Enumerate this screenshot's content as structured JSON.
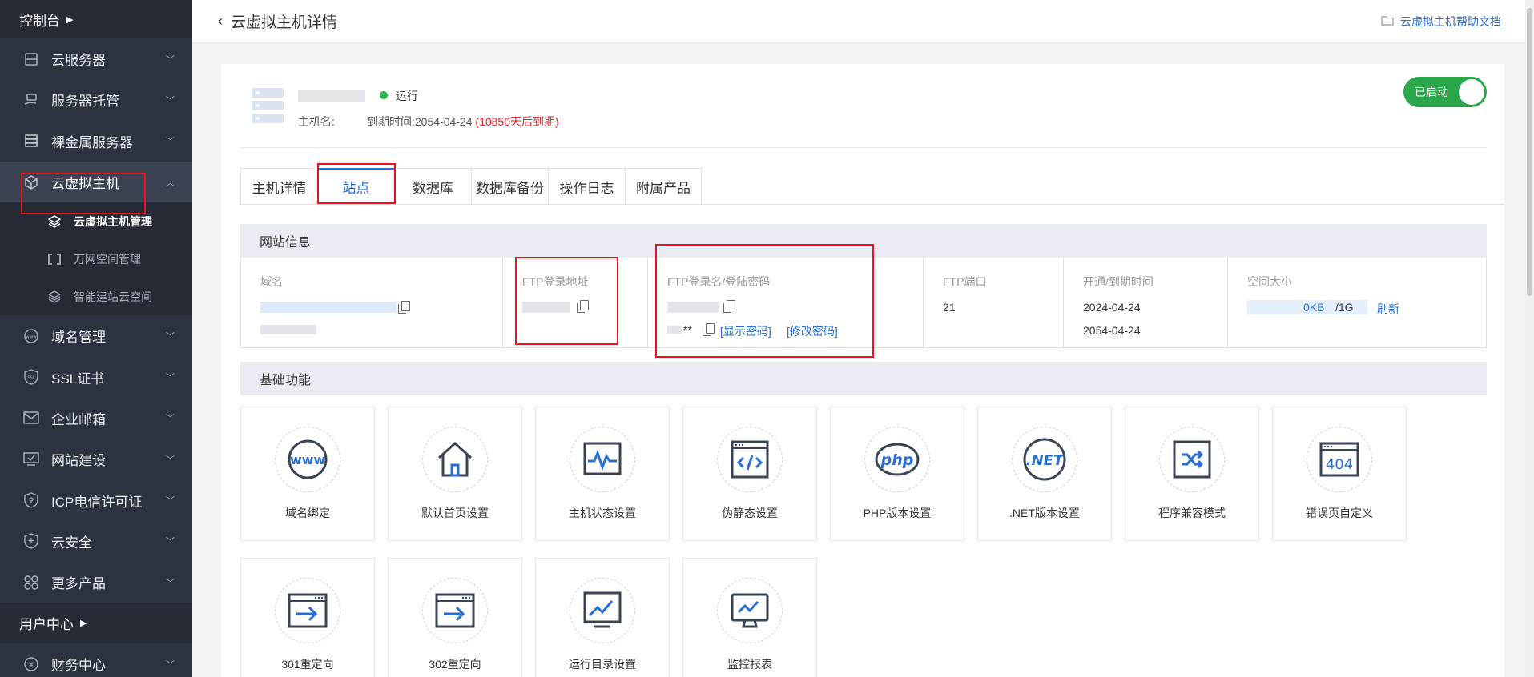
{
  "sidebar": {
    "top_label": "控制台",
    "items": [
      {
        "label": "云服务器",
        "icon": "server-icon"
      },
      {
        "label": "服务器托管",
        "icon": "hand-server-icon"
      },
      {
        "label": "裸金属服务器",
        "icon": "rack-icon"
      },
      {
        "label": "云虚拟主机",
        "icon": "cube-icon"
      }
    ],
    "sub_items": [
      {
        "label": "云虚拟主机管理",
        "icon": "layers-icon"
      },
      {
        "label": "万网空间管理",
        "icon": "bracket-icon"
      },
      {
        "label": "智能建站云空间",
        "icon": "stack-icon"
      }
    ],
    "items2": [
      {
        "label": "域名管理",
        "icon": "www-icon"
      },
      {
        "label": "SSL证书",
        "icon": "ssl-icon"
      },
      {
        "label": "企业邮箱",
        "icon": "mail-icon"
      },
      {
        "label": "网站建设",
        "icon": "monitor-icon"
      },
      {
        "label": "ICP电信许可证",
        "icon": "shield-icon"
      },
      {
        "label": "云安全",
        "icon": "shield-plus-icon"
      },
      {
        "label": "更多产品",
        "icon": "grid-icon"
      }
    ],
    "user_center": "用户中心",
    "finance": "财务中心"
  },
  "header": {
    "title": "云虚拟主机详情",
    "help_link": "云虚拟主机帮助文档"
  },
  "host": {
    "status": "运行",
    "host_label": "主机名:",
    "expire_prefix": "到期时间:2054-04-24",
    "expire_remain": "(10850天后到期)",
    "toggle_label": "已启动",
    "status_color": "#28b34b"
  },
  "tabs": [
    "主机详情",
    "站点",
    "数据库",
    "数据库备份",
    "操作日志",
    "附属产品"
  ],
  "site_info": {
    "title": "网站信息",
    "domain_label": "域名",
    "ftp_addr_label": "FTP登录地址",
    "ftp_login_label": "FTP登录名/登陆密码",
    "ftp_pwd_mask": "**",
    "show_pwd": "[显示密码]",
    "change_pwd": "[修改密码]",
    "ftp_port_label": "FTP端口",
    "ftp_port": "21",
    "dates_label": "开通/到期时间",
    "open_date": "2024-04-24",
    "expire_date": "2054-04-24",
    "space_label": "空间大小",
    "space_used": "0KB",
    "space_total": "/1G",
    "refresh": "刷新"
  },
  "basic": {
    "title": "基础功能",
    "features": [
      {
        "label": "域名绑定",
        "icon": "www-icon"
      },
      {
        "label": "默认首页设置",
        "icon": "home-icon"
      },
      {
        "label": "主机状态设置",
        "icon": "pulse-icon"
      },
      {
        "label": "伪静态设置",
        "icon": "code-icon"
      },
      {
        "label": "PHP版本设置",
        "icon": "php-icon"
      },
      {
        "label": ".NET版本设置",
        "icon": "dotnet-icon"
      },
      {
        "label": "程序兼容模式",
        "icon": "shuffle-icon"
      },
      {
        "label": "错误页自定义",
        "icon": "error-404-icon"
      },
      {
        "label": "301重定向",
        "icon": "redirect-icon"
      },
      {
        "label": "302重定向",
        "icon": "redirect-icon"
      },
      {
        "label": "运行目录设置",
        "icon": "chart-icon"
      },
      {
        "label": "监控报表",
        "icon": "monitor-chart-icon"
      }
    ]
  },
  "colors": {
    "accent": "#2a6fd6",
    "sidebar": "#2c3240",
    "annotation": "#e8141e"
  }
}
